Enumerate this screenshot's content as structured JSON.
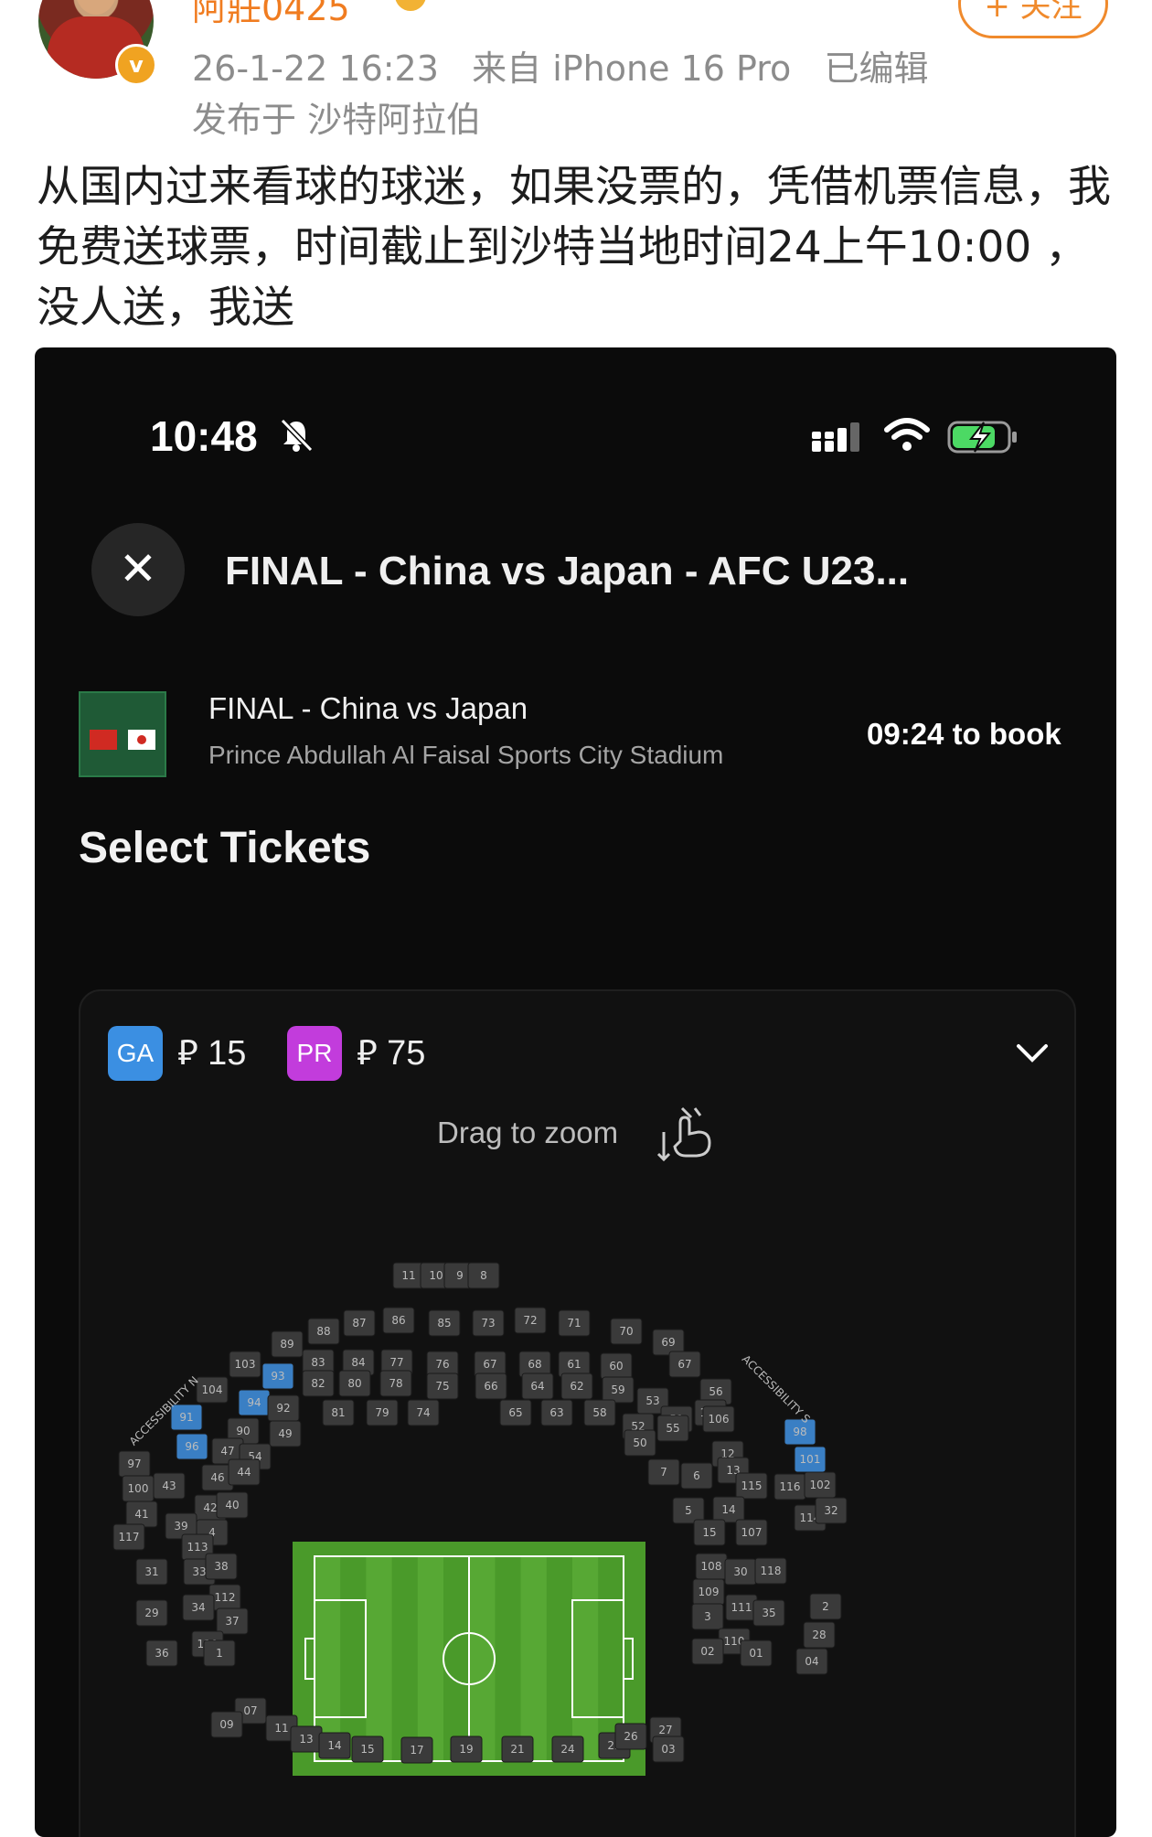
{
  "post": {
    "username": "阿莊0425",
    "meta_line": "26-1-22 16:23   来自 iPhone 16 Pro   已编辑",
    "location": "发布于 沙特阿拉伯",
    "follow_label": "+ 关注",
    "text": "从国内过来看球的球迷，如果没票的，凭借机票信息，我免费送球票，时间截止到沙特当地时间24上午10:00 ，没人送，我送"
  },
  "phone": {
    "status_time": "10:48",
    "nav_title": "FINAL - China vs Japan  - AFC U23...",
    "event_title": "FINAL - China vs Japan",
    "venue": "Prince Abdullah Al Faisal Sports City Stadium",
    "countdown": "09:24 to book",
    "section_title": "Select Tickets",
    "categories": [
      {
        "code": "GA",
        "price": "⃁ 15",
        "color": "#3b8fe2"
      },
      {
        "code": "PR",
        "price": "⃁ 75",
        "color": "#c23cdc"
      }
    ],
    "drag_hint": "Drag to zoom",
    "zones": [
      "11",
      "10",
      "9",
      "8",
      "88",
      "87",
      "86",
      "85",
      "73",
      "72",
      "71",
      "70",
      "69",
      "89",
      "83",
      "84",
      "77",
      "76",
      "67",
      "68",
      "61",
      "60",
      "67",
      "103",
      "93",
      "82",
      "80",
      "78",
      "75",
      "66",
      "64",
      "62",
      "59",
      "53",
      "56",
      "104",
      "94",
      "92",
      "81",
      "79",
      "74",
      "65",
      "63",
      "58",
      "52",
      "51",
      "105",
      "91",
      "90",
      "49",
      "50",
      "55",
      "106",
      "96",
      "47",
      "54",
      "7",
      "12",
      "98",
      "97",
      "46",
      "44",
      "6",
      "13",
      "115",
      "101",
      "100",
      "43",
      "42",
      "40",
      "5",
      "14",
      "116",
      "102",
      "41",
      "39",
      "4",
      "15",
      "114",
      "32",
      "117",
      "113",
      "107",
      "31",
      "33",
      "38",
      "108",
      "30",
      "118",
      "112",
      "109",
      "29",
      "34",
      "37",
      "3",
      "111",
      "35",
      "2",
      "119",
      "110",
      "28",
      "36",
      "1",
      "02",
      "01",
      "04",
      "07",
      "09",
      "11",
      "13",
      "14",
      "15",
      "17",
      "19",
      "21",
      "24",
      "25",
      "26",
      "27",
      "03"
    ],
    "accessibility_label_n": "ACCESSIBILITY N",
    "accessibility_label_s": "ACCESSIBILITY S",
    "highlighted_zones": [
      "93",
      "94",
      "91",
      "96",
      "98",
      "101"
    ]
  }
}
